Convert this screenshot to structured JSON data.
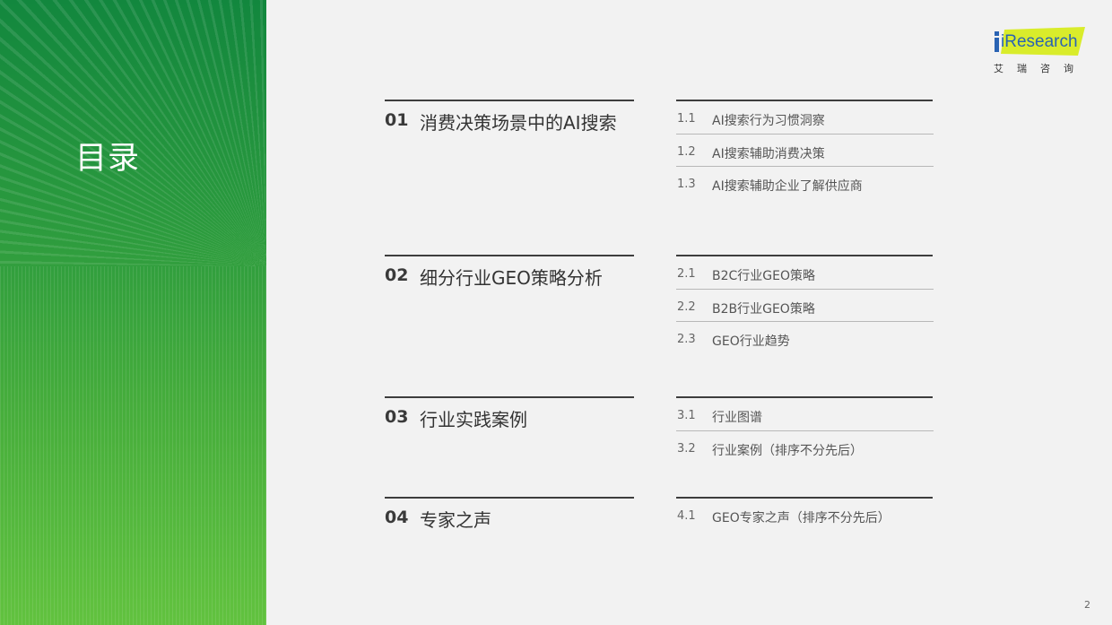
{
  "sidebar": {
    "title": "目录"
  },
  "logo": {
    "brand": "iResearch",
    "subtitle": "艾瑞咨询"
  },
  "sections": [
    {
      "number": "01",
      "title": "消费决策场景中的AI搜索",
      "items": [
        {
          "number": "1.1",
          "label": "AI搜索行为习惯洞察"
        },
        {
          "number": "1.2",
          "label": "AI搜索辅助消费决策"
        },
        {
          "number": "1.3",
          "label": "AI搜索辅助企业了解供应商"
        }
      ]
    },
    {
      "number": "02",
      "title": "细分行业GEO策略分析",
      "items": [
        {
          "number": "2.1",
          "label": "B2C行业GEO策略"
        },
        {
          "number": "2.2",
          "label": "B2B行业GEO策略"
        },
        {
          "number": "2.3",
          "label": "GEO行业趋势"
        }
      ]
    },
    {
      "number": "03",
      "title": "行业实践案例",
      "items": [
        {
          "number": "3.1",
          "label": "行业图谱"
        },
        {
          "number": "3.2",
          "label": "行业案例（排序不分先后）"
        }
      ]
    },
    {
      "number": "04",
      "title": "专家之声",
      "items": [
        {
          "number": "4.1",
          "label": "GEO专家之声（排序不分先后）"
        }
      ]
    }
  ],
  "page_number": "2",
  "colors": {
    "accent_green": "#2b9a3e",
    "logo_yellow": "#d9ec2b",
    "logo_blue": "#2a63b3"
  }
}
